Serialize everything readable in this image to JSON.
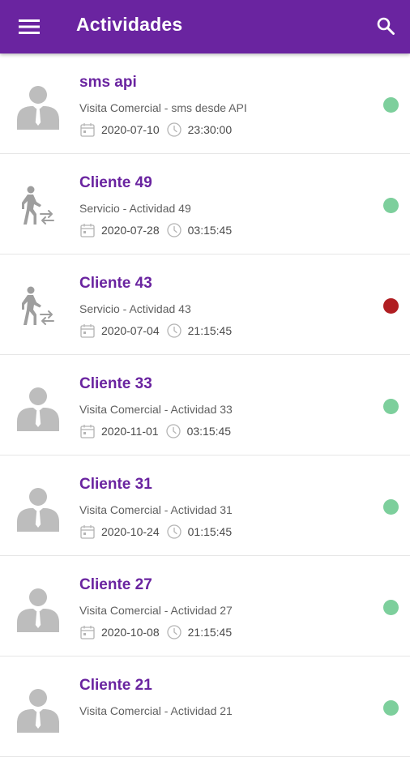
{
  "appbar": {
    "title": "Actividades",
    "menu_icon": "menu-icon",
    "search_icon": "search-icon",
    "color": "#6a24a0"
  },
  "status_colors": {
    "active": "#7dcf9c",
    "inactive": "#b01e22"
  },
  "activities": [
    {
      "name": "sms api",
      "description": "Visita Comercial - sms desde API",
      "date": "2020-07-10",
      "time": "23:30:00",
      "icon": "person-avatar-icon",
      "status": "active"
    },
    {
      "name": "Cliente 49",
      "description": "Servicio - Actividad 49",
      "date": "2020-07-28",
      "time": "03:15:45",
      "icon": "walking-person-transfer-icon",
      "status": "active"
    },
    {
      "name": "Cliente 43",
      "description": "Servicio - Actividad 43",
      "date": "2020-07-04",
      "time": "21:15:45",
      "icon": "walking-person-transfer-icon",
      "status": "inactive"
    },
    {
      "name": "Cliente 33",
      "description": "Visita Comercial - Actividad 33",
      "date": "2020-11-01",
      "time": "03:15:45",
      "icon": "person-avatar-icon",
      "status": "active"
    },
    {
      "name": "Cliente 31",
      "description": "Visita Comercial - Actividad 31",
      "date": "2020-10-24",
      "time": "01:15:45",
      "icon": "person-avatar-icon",
      "status": "active"
    },
    {
      "name": "Cliente 27",
      "description": "Visita Comercial - Actividad 27",
      "date": "2020-10-08",
      "time": "21:15:45",
      "icon": "person-avatar-icon",
      "status": "active"
    },
    {
      "name": "Cliente 21",
      "description": "Visita Comercial - Actividad 21",
      "date": "",
      "time": "",
      "icon": "person-avatar-icon",
      "status": "active"
    }
  ]
}
